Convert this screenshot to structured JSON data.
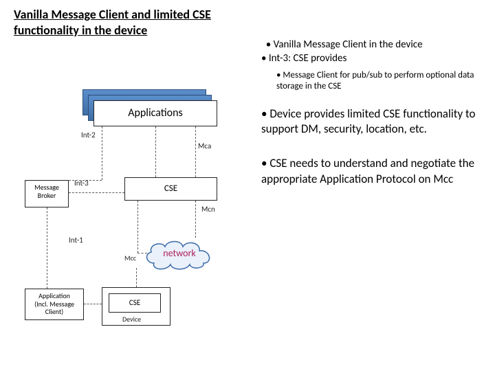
{
  "title": "Vanilla Message Client and limited CSE functionality in the device",
  "top_bullets": {
    "b1": "Vanilla Message Client in the device",
    "b2": "Int-3: CSE provides"
  },
  "sub_bullet": "Message Client for pub/sub to perform optional data storage in the CSE",
  "big_bullets": {
    "p1": "Device provides limited CSE functionality to support DM, security, location, etc.",
    "p2": "CSE needs to understand and negotiate the appropriate Application Protocol on Mcc"
  },
  "diagram": {
    "applications": "Applications",
    "mca": "Mca",
    "int2": "Int-2",
    "msg_broker_l1": "Message",
    "msg_broker_l2": "Broker",
    "int3": "Int-3",
    "cse": "CSE",
    "mcn": "Mcn",
    "int1": "Int-1",
    "mcc": "Mcc",
    "network": "network",
    "app_incl_l1": "Application",
    "app_incl_l2": "(Incl. Message",
    "app_incl_l3": "Client)",
    "cse2": "CSE",
    "device": "Device"
  }
}
